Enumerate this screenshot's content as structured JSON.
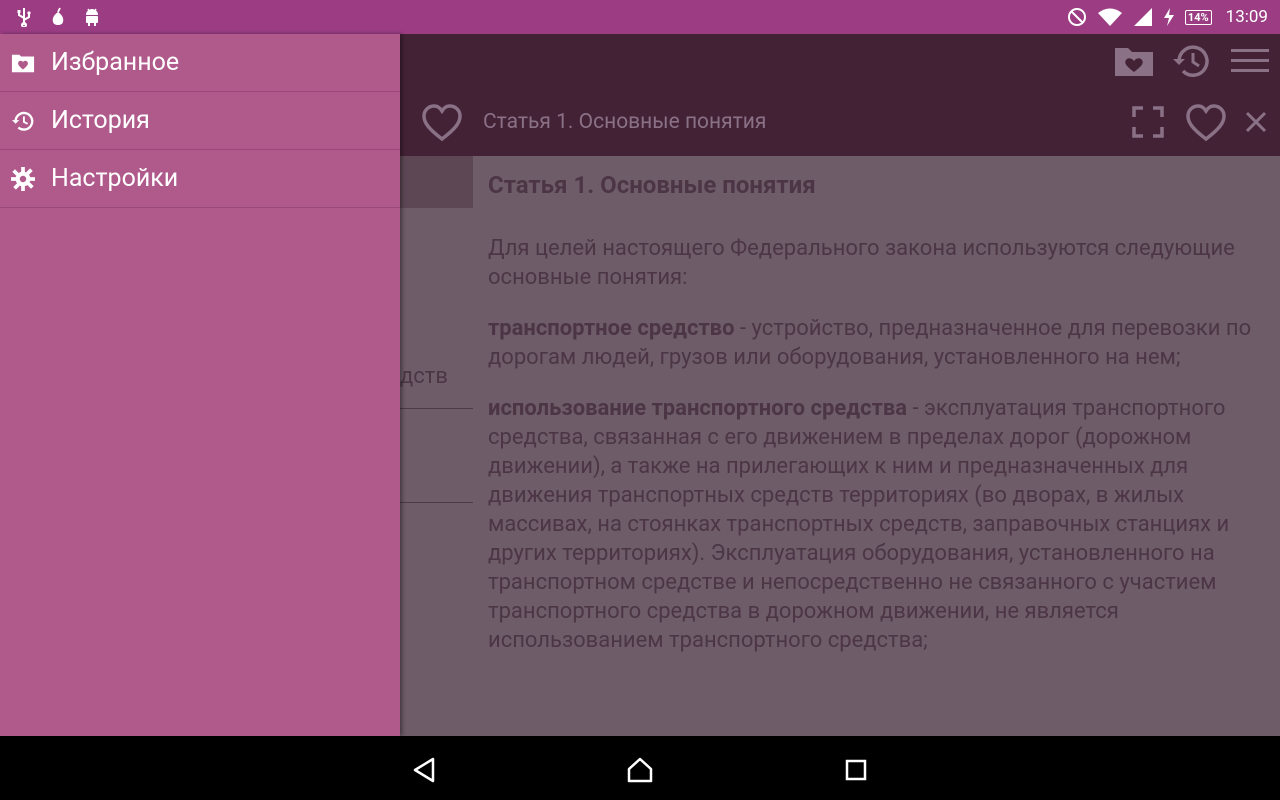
{
  "status_bar": {
    "time": "13:09",
    "battery": "14%",
    "left_icons": [
      "usb-icon",
      "pear-icon",
      "android-icon"
    ],
    "right_icons": [
      "do-not-disturb-icon",
      "wifi-icon",
      "signal-icon",
      "charging-icon",
      "battery-icon"
    ]
  },
  "colors": {
    "status_bar": "#9c3d84",
    "toolbar": "#432236",
    "drawer": "#b05a8c",
    "content_bg": "#6e5c69"
  },
  "toolbar": {
    "icons": [
      "favorites-folder-icon",
      "history-icon",
      "menu-icon"
    ],
    "article_title": "Статья 1. Основные понятия",
    "article_icons": [
      "fullscreen-icon",
      "favorite-heart-icon",
      "close-icon"
    ]
  },
  "drawer": {
    "items": [
      {
        "label": "Избранное",
        "icon": "favorites-folder-icon"
      },
      {
        "label": "История",
        "icon": "history-icon"
      },
      {
        "label": "Настройки",
        "icon": "settings-gear-icon"
      }
    ]
  },
  "left_pane": {
    "partial_text": "дств"
  },
  "article": {
    "heading": "Статья 1. Основные понятия",
    "intro": "Для целей настоящего Федерального закона используются следующие основные понятия:",
    "definitions": [
      {
        "term": "транспортное средство",
        "text": " - устройство, предназначенное для перевозки по дорогам людей, грузов или оборудования, установленного на нем;"
      },
      {
        "term": "использование транспортного средства",
        "text": " - эксплуатация транспортного средства, связанная с его движением в пределах дорог (дорожном движении), а также на прилегающих к ним и предназначенных для движения транспортных средств территориях (во дворах, в жилых массивах, на стоянках транспортных средств, заправочных станциях и других территориях). Эксплуатация оборудования, установленного на транспортном средстве и непосредственно не связанного с участием транспортного средства в дорожном движении, не является использованием транспортного средства;"
      }
    ]
  },
  "nav_bar": {
    "buttons": [
      "back-icon",
      "home-icon",
      "recents-icon"
    ]
  }
}
